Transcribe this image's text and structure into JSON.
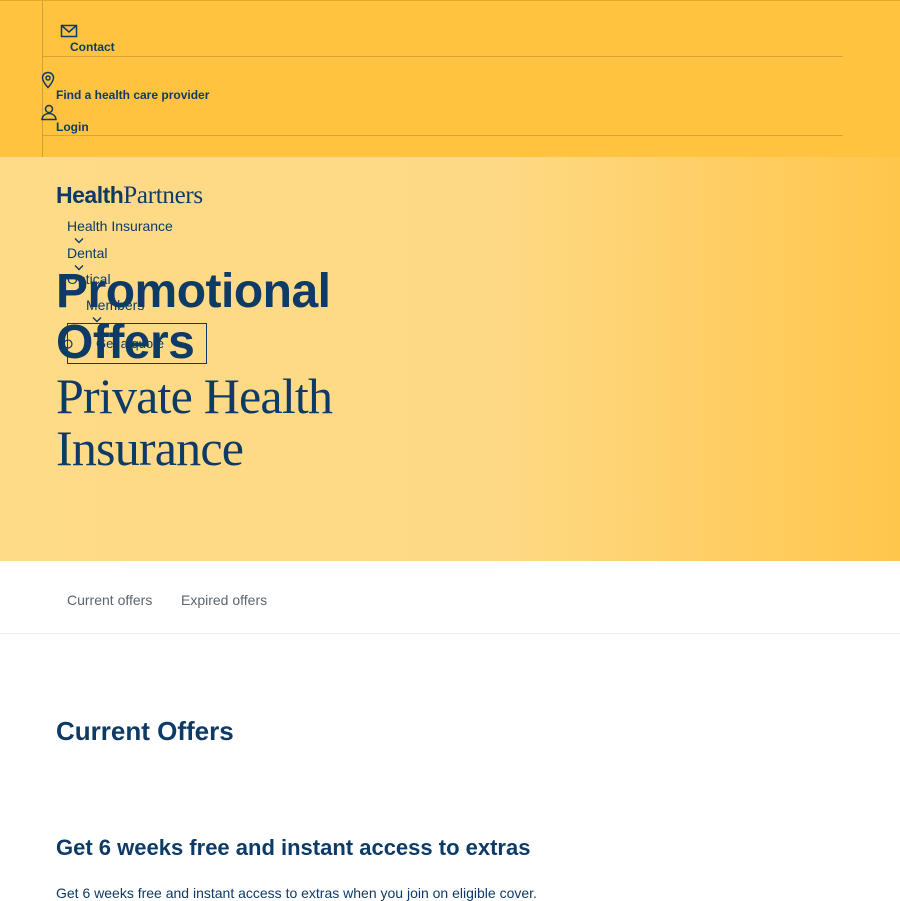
{
  "utility_bar": {
    "links": [
      {
        "label": "Contact",
        "icon": "mail-icon"
      },
      {
        "label": "Find a health care provider",
        "icon": "location-pin-icon"
      },
      {
        "label": "Login",
        "icon": "user-icon"
      }
    ]
  },
  "logo": {
    "part1": "Health",
    "part2": "Partners"
  },
  "nav": {
    "items": [
      {
        "label": "Health Insurance",
        "has_dropdown": true
      },
      {
        "label": "Dental",
        "has_dropdown": true
      },
      {
        "label": "Optical",
        "has_dropdown": false
      },
      {
        "label": "Members",
        "has_dropdown": true
      }
    ],
    "cta": {
      "label": "Get a quote"
    }
  },
  "hero": {
    "title": "Promotional Offers",
    "subtitle": "Private Health Insurance"
  },
  "tabs": [
    {
      "label": "Current offers"
    },
    {
      "label": "Expired offers"
    }
  ],
  "main": {
    "section_title": "Current Offers",
    "offer": {
      "title": "Get 6 weeks free and instant access to extras",
      "description": "Get 6 weeks free and instant access to extras when you join on eligible cover."
    }
  },
  "colors": {
    "brand_navy": "#0d3b66",
    "utility_yellow": "#ffc340",
    "hero_yellow": "#fedb87"
  }
}
